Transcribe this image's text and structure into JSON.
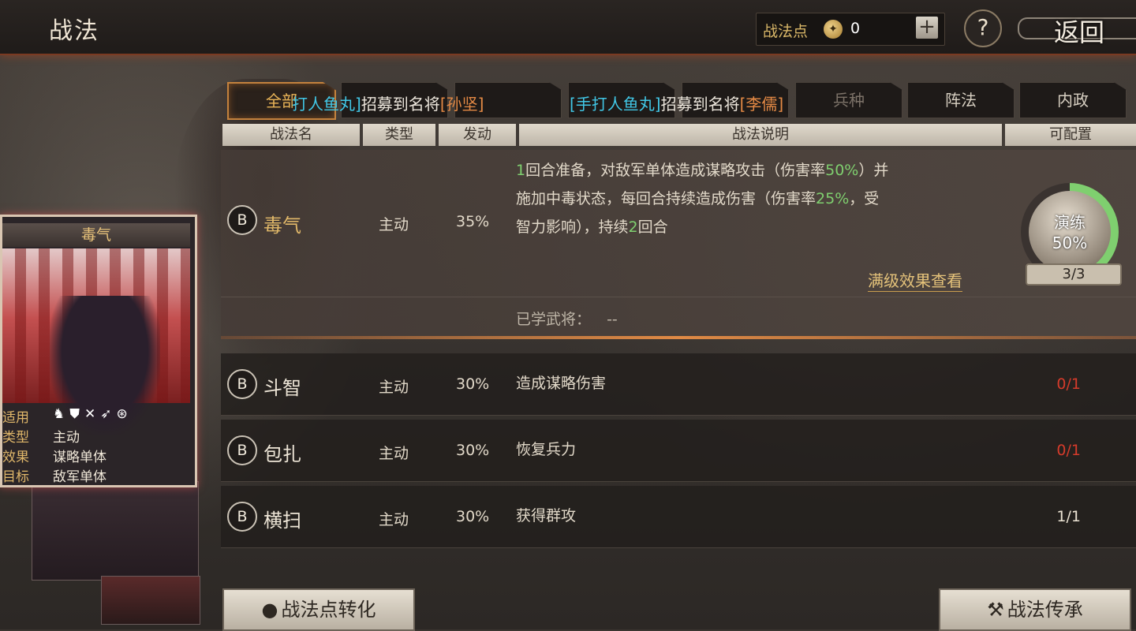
{
  "header": {
    "title": "战法",
    "points_label": "战法点",
    "points_value": "0",
    "plus_label": "+",
    "help_label": "?",
    "back_label": "返回"
  },
  "tabs": [
    {
      "label": "全部",
      "active": true
    },
    {
      "label": "",
      "active": false
    },
    {
      "label": "",
      "active": false
    },
    {
      "label": "",
      "active": false
    },
    {
      "label": "",
      "active": false
    },
    {
      "label": "兵种",
      "active": false
    },
    {
      "label": "阵法",
      "active": false
    },
    {
      "label": "内政",
      "active": false
    }
  ],
  "ticker": [
    {
      "part1": "打人鱼丸]",
      "part2": "招募到名将",
      "part3": "[孙坚]"
    },
    {
      "part1": "[手打人鱼丸]",
      "part2": "招募到名将",
      "part3": "[李儒]"
    }
  ],
  "table_header": {
    "name": "战法名",
    "type": "类型",
    "rate": "发动",
    "desc": "战法说明",
    "config": "可配置"
  },
  "expanded": {
    "grade": "B",
    "name": "毒气",
    "type": "主动",
    "rate": "35%",
    "desc_line1_a": "1",
    "desc_line1_b": "回合准备，对敌军单体造成谋略攻击（伤害率",
    "desc_line1_c": "50%",
    "desc_line1_d": "）并",
    "desc_line2_a": "施加中毒状态，每回合持续造成伤害（伤害率",
    "desc_line2_b": "25%",
    "desc_line2_c": "，受",
    "desc_line3_a": "智力影响），持续",
    "desc_line3_b": "2",
    "desc_line3_c": "回合",
    "full_effect_link": "满级效果查看",
    "learned_label": "已学武将：",
    "learned_value": "--",
    "training_label": "演练",
    "training_pct": "50%",
    "training_progress": 0.5,
    "config": "3/3"
  },
  "rows": [
    {
      "grade": "B",
      "name": "斗智",
      "type": "主动",
      "rate": "30%",
      "desc": "造成谋略伤害",
      "config": "0/1",
      "config_red": true
    },
    {
      "grade": "B",
      "name": "包扎",
      "type": "主动",
      "rate": "30%",
      "desc": "恢复兵力",
      "config": "0/1",
      "config_red": true
    },
    {
      "grade": "B",
      "name": "横扫",
      "type": "主动",
      "rate": "30%",
      "desc": "获得群攻",
      "config": "1/1",
      "config_red": false
    }
  ],
  "card": {
    "title": "毒气",
    "apply_key": "适用",
    "type_key": "类型",
    "type_val": "主动",
    "effect_key": "效果",
    "effect_val": "谋略单体",
    "target_key": "目标",
    "target_val": "敌军单体"
  },
  "buttons": {
    "convert": "战法点转化",
    "inherit": "战法传承"
  },
  "colors": {
    "accent_gold": "#e1b869",
    "highlight_green": "#7fcf6f",
    "warning_red": "#d53b2b",
    "ticker_cyan": "#41c7e6",
    "ticker_orange": "#e58a45"
  }
}
